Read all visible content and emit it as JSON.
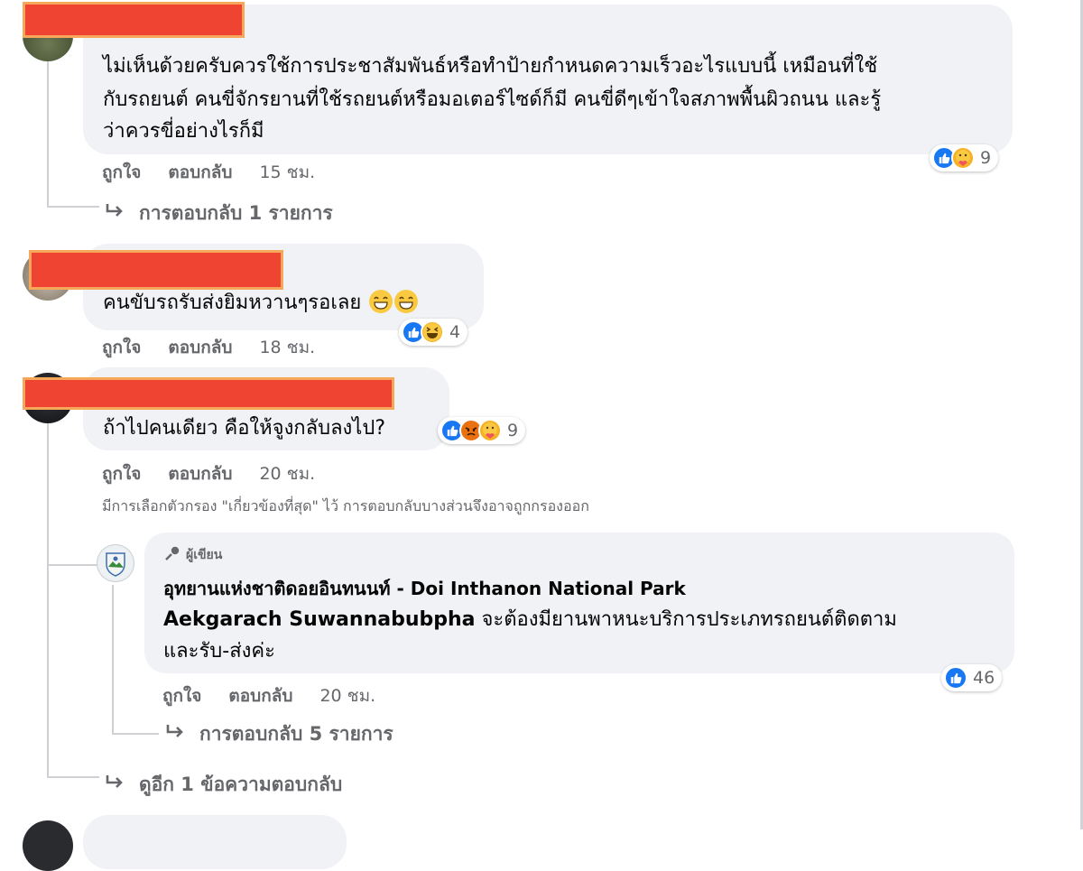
{
  "comments": [
    {
      "text_lines": [
        "ไม่เห็นด้วยครับควรใช้การประชาสัมพันธ์หรือทำป้ายกำหนดความเร็วอะไรแบบนี้ เหมือนที่ใช้",
        "กับรถยนต์ คนขี่จักรยานที่ใช้รถยนต์หรือมอเตอร์ไซด์ก็มี คนขี่ดีๆเข้าใจสภาพพื้นผิวถนน และรู้",
        "ว่าควรขี่อย่างไรก็มี"
      ],
      "like_label": "ถูกใจ",
      "reply_label": "ตอบกลับ",
      "time": "15 ชม.",
      "reaction_count": "9",
      "reactions": [
        "like-icon",
        "care-icon"
      ],
      "replies_link": {
        "prefix": "การตอบกลับ",
        "count": "1",
        "suffix": "รายการ"
      }
    },
    {
      "text": "คนขับรถรับส่งยิมหวานๆรอเลย",
      "emojis": [
        "grinning-face-icon",
        "grinning-face-icon"
      ],
      "like_label": "ถูกใจ",
      "reply_label": "ตอบกลับ",
      "time": "18 ชม.",
      "reaction_count": "4",
      "reactions": [
        "like-icon",
        "haha-icon"
      ]
    },
    {
      "text": "ถ้าไปคนเดียว คือให้จูงกลับลงไป?",
      "like_label": "ถูกใจ",
      "reply_label": "ตอบกลับ",
      "time": "20 ชม.",
      "reaction_count": "9",
      "reactions": [
        "like-icon",
        "angry-icon",
        "care-icon"
      ],
      "filter_note": "มีการเลือกตัวกรอง \"เกี่ยวข้องที่สุด\" ไว้ การตอบกลับบางส่วนจึงอาจถูกกรองออก",
      "reply": {
        "author_badge": "ผู้เขียน",
        "page_name": "อุทยานแห่งชาติดอยอินทนนท์ - Doi Inthanon National Park",
        "mention": "Aekgarach Suwannabubpha",
        "text_line1": " จะต้องมียานพาหนะบริการประเภทรถยนต์ติดตาม",
        "text_line2": "และรับ-ส่งค่ะ",
        "like_label": "ถูกใจ",
        "reply_label": "ตอบกลับ",
        "time": "20 ชม.",
        "reaction_count": "46",
        "reactions": [
          "like-icon"
        ],
        "replies_link": {
          "prefix": "การตอบกลับ",
          "count": "5",
          "suffix": "รายการ"
        }
      },
      "more_replies": {
        "prefix": "ดูอีก",
        "count": "1",
        "suffix": "ข้อความตอบกลับ"
      }
    }
  ],
  "colors": {
    "bubble": "#f0f2f5",
    "meta_text": "#65676b",
    "like_blue": "#1877f2",
    "redaction": "#ee4431"
  }
}
